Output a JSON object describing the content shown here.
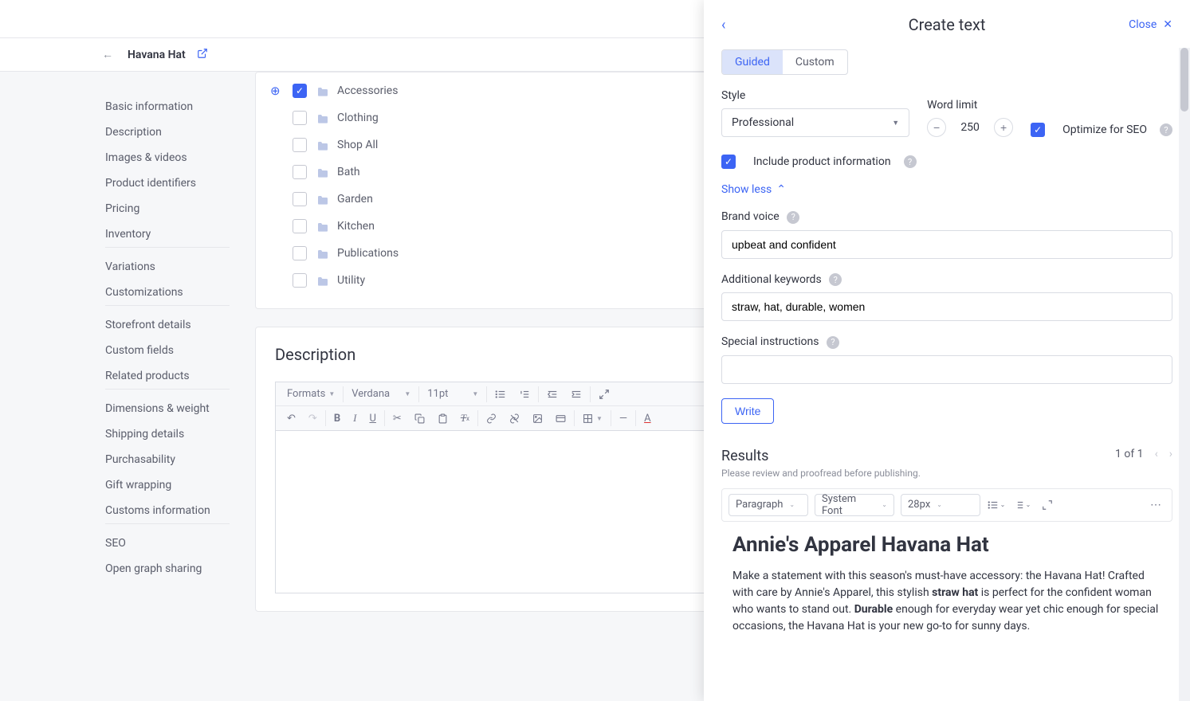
{
  "header": {
    "product_title": "Havana Hat"
  },
  "sidebar": {
    "groups": [
      [
        "Basic information",
        "Description",
        "Images & videos",
        "Product identifiers",
        "Pricing",
        "Inventory"
      ],
      [
        "Variations",
        "Customizations"
      ],
      [
        "Storefront details",
        "Custom fields",
        "Related products"
      ],
      [
        "Dimensions & weight",
        "Shipping details",
        "Purchasability",
        "Gift wrapping",
        "Customs information"
      ],
      [
        "SEO",
        "Open graph sharing"
      ]
    ]
  },
  "categories": [
    {
      "label": "Accessories",
      "checked": true,
      "add": true
    },
    {
      "label": "Clothing",
      "checked": false
    },
    {
      "label": "Shop All",
      "checked": false
    },
    {
      "label": "Bath",
      "checked": false
    },
    {
      "label": "Garden",
      "checked": false
    },
    {
      "label": "Kitchen",
      "checked": false
    },
    {
      "label": "Publications",
      "checked": false
    },
    {
      "label": "Utility",
      "checked": false
    }
  ],
  "desc_section": {
    "title": "Description",
    "toolbar": {
      "formats": "Formats",
      "font": "Verdana",
      "size": "11pt"
    }
  },
  "panel": {
    "title": "Create text",
    "close": "Close",
    "tabs": {
      "guided": "Guided",
      "custom": "Custom"
    },
    "style_label": "Style",
    "style_value": "Professional",
    "wordlimit_label": "Word limit",
    "wordlimit_value": "250",
    "seo_label": "Optimize for SEO",
    "include_label": "Include product information",
    "showless": "Show less",
    "brand_voice_label": "Brand voice",
    "brand_voice_value": "upbeat and confident",
    "keywords_label": "Additional keywords",
    "keywords_value": "straw, hat, durable, women",
    "special_label": "Special instructions",
    "special_value": "",
    "write": "Write",
    "results_label": "Results",
    "results_sub": "Please review and proofread before publishing.",
    "pager": "1 of 1",
    "rt_format": "Paragraph",
    "rt_font": "System Font",
    "rt_size": "28px",
    "result_title": "Annie's Apparel Havana Hat",
    "result_body_1": "Make a statement with this season's must-have accessory: the Havana Hat! Crafted with care by Annie's Apparel, this stylish ",
    "result_body_bold1": "straw hat",
    "result_body_2": " is perfect for the confident woman who wants to stand out. ",
    "result_body_bold2": "Durable",
    "result_body_3": " enough for everyday wear yet chic enough for special occasions, the Havana Hat is your new go-to for sunny days."
  }
}
